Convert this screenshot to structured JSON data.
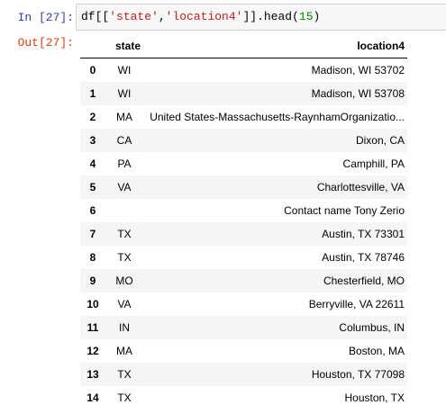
{
  "cell": {
    "in_prompt": "In [27]:",
    "out_prompt": "Out[27]:",
    "code": {
      "prefix": "df[[",
      "str1": "'state'",
      "sep": ",",
      "str2": "'location4'",
      "mid": "]].head(",
      "num": "15",
      "suffix": ")"
    }
  },
  "table": {
    "headers": {
      "index": "",
      "state": "state",
      "location": "location4"
    },
    "rows": [
      {
        "index": "0",
        "state": "WI",
        "location": "Madison, WI 53702"
      },
      {
        "index": "1",
        "state": "WI",
        "location": "Madison, WI 53708"
      },
      {
        "index": "2",
        "state": "MA",
        "location": "United States-Massachusetts-RaynhamOrganizatio..."
      },
      {
        "index": "3",
        "state": "CA",
        "location": "Dixon, CA"
      },
      {
        "index": "4",
        "state": "PA",
        "location": "Camphill, PA"
      },
      {
        "index": "5",
        "state": "VA",
        "location": "Charlottesville, VA"
      },
      {
        "index": "6",
        "state": "",
        "location": "Contact name Tony Zerio"
      },
      {
        "index": "7",
        "state": "TX",
        "location": "Austin, TX 73301"
      },
      {
        "index": "8",
        "state": "TX",
        "location": "Austin, TX 78746"
      },
      {
        "index": "9",
        "state": "MO",
        "location": "Chesterfield, MO"
      },
      {
        "index": "10",
        "state": "VA",
        "location": "Berryville, VA 22611"
      },
      {
        "index": "11",
        "state": "IN",
        "location": "Columbus, IN"
      },
      {
        "index": "12",
        "state": "MA",
        "location": "Boston, MA"
      },
      {
        "index": "13",
        "state": "TX",
        "location": "Houston, TX 77098"
      },
      {
        "index": "14",
        "state": "TX",
        "location": "Houston, TX"
      }
    ]
  },
  "colors": {
    "in_prompt": "#303f9f",
    "out_prompt": "#d84315",
    "string_literal": "#ba2121",
    "number_literal": "#008800",
    "stripe": "#f5f5f5"
  }
}
